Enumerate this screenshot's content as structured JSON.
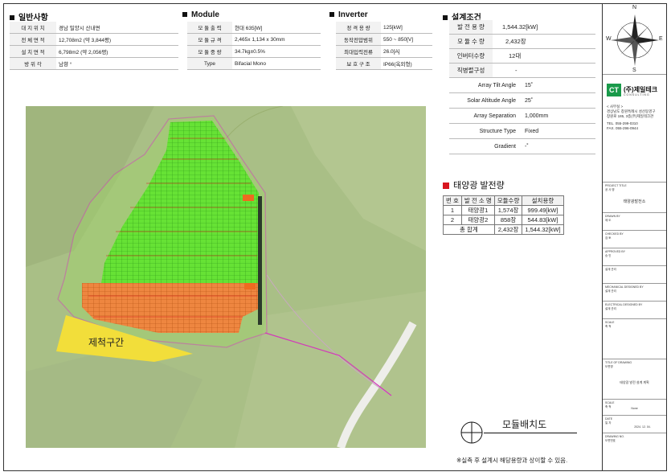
{
  "sections": {
    "general": {
      "title": "일반사항",
      "rows": [
        {
          "k": "대 지 위 치",
          "v": "경남 밀양시 산내면"
        },
        {
          "k": "전 체 면 적",
          "v": "12,708m2 (약 3,844평)"
        },
        {
          "k": "설 치 면 적",
          "v": "6,798m2 (약 2,056평)"
        },
        {
          "k": "방 위 각",
          "v": "남향 °"
        }
      ]
    },
    "module": {
      "title": "Module",
      "rows": [
        {
          "k": "모 듈 출 력",
          "v": "현대 635[W]"
        },
        {
          "k": "모 듈 규 격",
          "v": "2,465x 1,134 x 30mm"
        },
        {
          "k": "모 듈 중 량",
          "v": "34.7kg±0.5%"
        },
        {
          "k": "Type",
          "v": "Bifacial Mono"
        }
      ]
    },
    "inverter": {
      "title": "Inverter",
      "rows": [
        {
          "k": "정 격 용 량",
          "v": "125[kW]"
        },
        {
          "k": "동작전압범위",
          "v": "550 ~ 850[V]"
        },
        {
          "k": "최대입력전류",
          "v": "26.0[A]"
        },
        {
          "k": "보 호 구 조",
          "v": "IP66(옥외형)"
        }
      ]
    },
    "design": {
      "title": "설계조건",
      "rows": [
        {
          "k": "발 전 용 량",
          "v": "1,544.32[kW]"
        },
        {
          "k": "모 듈 수 량",
          "v": "2,432장"
        },
        {
          "k": "인버터수량",
          "v": "12대"
        },
        {
          "k": "직병렬구성",
          "v": "-"
        },
        {
          "k": "Array Tilt Angle",
          "v": "15˚"
        },
        {
          "k": "Solar Altitude Angle",
          "v": "25˚"
        },
        {
          "k": "Array Separation",
          "v": "1,000mm"
        },
        {
          "k": "Structure Type",
          "v": "Fixed"
        },
        {
          "k": "Gradient",
          "v": "-˚"
        }
      ]
    }
  },
  "generation": {
    "title": "태양광 발전량",
    "headers": [
      "번 호",
      "발 전 소 명",
      "모듈수량",
      "설치용량"
    ],
    "rows": [
      [
        "1",
        "태양광1",
        "1,574장",
        "999.49[kW]"
      ],
      [
        "2",
        "태양광2",
        "858장",
        "544.83[kW]"
      ]
    ],
    "total": [
      "총 합계",
      "2,432장",
      "1,544.32[kW]"
    ]
  },
  "map": {
    "restricted_label": "제척구간",
    "plan_title": "모듈배치도",
    "plan_symbol": "1"
  },
  "note": "※실측 후 설계시 해당용량과 상이할 수 있음.",
  "compass": {
    "n": "N",
    "s": "S",
    "e": "E",
    "w": "W"
  },
  "company": {
    "logo_text": "CT",
    "name": "(주)제일테크",
    "sub": "CONSULTING",
    "section": "< 사무실 >",
    "address1": "경상남도 창원특례시 성산동영구",
    "address2": "창원로 185, 3층(주)제일테크관",
    "tel": "TEL. 055-299-0310",
    "fax": "FAX. 055-296-0944"
  },
  "titleblock": {
    "project_label": "PROJECT TITLE\n공 사 명",
    "project_value": "태양광발전소",
    "drawn_label": "DRAWN BY\n제 도",
    "checked_label": "CHECKED BY\n검 토",
    "approved_label": "APPROVED BY\n승 인",
    "design_label": "설계 관리",
    "mech_label": "MECHANICAL DESIGNED BY\n설계 관리",
    "elec_label": "ELECTRICAL DESIGNED BY\n설계 관리",
    "scale_label": "SCALE\n축 척",
    "title_label": "TITLE OF DRAWING\n도면명",
    "title_value": "태양광 발전 설계 계획",
    "scale2_label": "SCALE\n축 척",
    "scale2_value": "None",
    "date_label": "DATE\n일 자",
    "date_value": "2024. 12. 04.",
    "dwg_label": "DRAWING NO.\n도면번호"
  },
  "colors": {
    "green_module": "#66e235",
    "orange_module": "#ee8640",
    "boundary": "#d23ab9",
    "restricted": "#f2de3a"
  }
}
